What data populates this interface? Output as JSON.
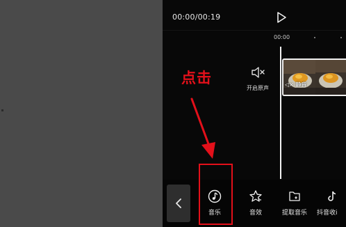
{
  "player": {
    "time": "00:00/00:19"
  },
  "timeline": {
    "start_time": "00:00"
  },
  "audio": {
    "mute_label": "开启原声",
    "clip_badge": "静音"
  },
  "toolbar": {
    "items": [
      {
        "label": "音乐",
        "icon": "music-note-icon"
      },
      {
        "label": "音效",
        "icon": "sound-effect-icon"
      },
      {
        "label": "提取音乐",
        "icon": "extract-music-icon"
      },
      {
        "label": "抖音收i",
        "icon": "tiktok-icon"
      }
    ]
  },
  "annotation": {
    "text": "点击"
  },
  "colors": {
    "annotation_red": "#e3101a",
    "panel_gray": "#4a4a4a",
    "editor_bg": "#080808"
  }
}
